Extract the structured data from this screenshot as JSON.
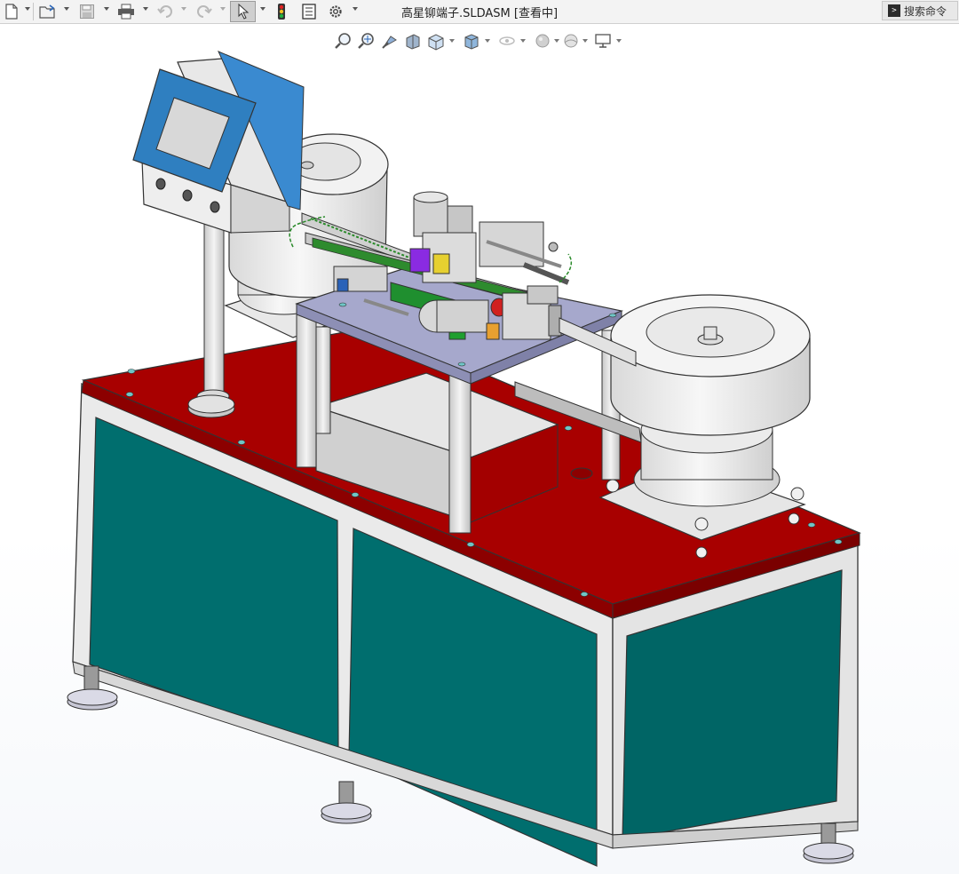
{
  "window": {
    "title": "高星铆端子.SLDASM [查看中]"
  },
  "toolbar": {
    "items": [
      {
        "name": "new-document",
        "icon": "new-document-icon"
      },
      {
        "name": "open",
        "icon": "open-folder-icon"
      },
      {
        "name": "save",
        "icon": "save-icon"
      },
      {
        "name": "print",
        "icon": "print-icon"
      },
      {
        "name": "undo",
        "icon": "undo-icon"
      },
      {
        "name": "redo",
        "icon": "redo-icon"
      },
      {
        "name": "select",
        "icon": "cursor-icon"
      },
      {
        "name": "rebuild",
        "icon": "traffic-light-icon"
      },
      {
        "name": "file-properties",
        "icon": "properties-icon"
      },
      {
        "name": "options",
        "icon": "gear-icon"
      }
    ]
  },
  "search": {
    "label": "搜索命令"
  },
  "view_toolbar": {
    "items": [
      {
        "name": "zoom-to-fit",
        "icon": "zoom-fit-icon"
      },
      {
        "name": "zoom-to-area",
        "icon": "zoom-area-icon"
      },
      {
        "name": "previous-view",
        "icon": "previous-view-icon"
      },
      {
        "name": "section-view",
        "icon": "section-view-icon"
      },
      {
        "name": "view-orientation",
        "icon": "view-orientation-icon"
      },
      {
        "name": "display-style",
        "icon": "display-style-icon"
      },
      {
        "name": "hide-show-items",
        "icon": "hide-show-icon"
      },
      {
        "name": "edit-appearance",
        "icon": "appearance-icon"
      },
      {
        "name": "apply-scene",
        "icon": "scene-icon"
      },
      {
        "name": "view-settings",
        "icon": "monitor-icon"
      }
    ]
  },
  "model": {
    "description": "riveting terminal assembly machine",
    "colors": {
      "tabletop": "#a80000",
      "cabinet_panel": "#006e6e",
      "frame": "#e9e9e9",
      "hmi_screen": "#2f7fc0",
      "plate": "#a6a8cc",
      "bowl": "#f0f0f0"
    }
  }
}
